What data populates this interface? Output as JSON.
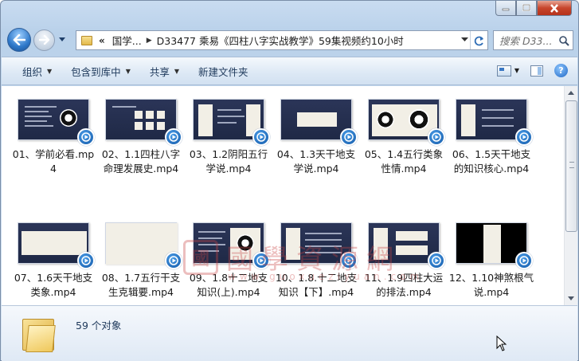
{
  "window": {
    "minimize_icon": "minimize-icon",
    "maximize_icon": "maximize-icon",
    "close_icon": "close-icon"
  },
  "address": {
    "prefix": "«",
    "segments": [
      "国学...",
      "D33477 乘易《四柱八字实战教学》59集视频约10小时"
    ]
  },
  "search": {
    "placeholder": "搜索 D33..."
  },
  "toolbar": {
    "organize": "组织",
    "include_library": "包含到库中",
    "share": "共享",
    "new_folder": "新建文件夹"
  },
  "items": [
    {
      "name": "01、学前必看.mp4",
      "thumb": "text"
    },
    {
      "name": "02、1.1四柱八字命理发展史.mp4",
      "thumb": "grid"
    },
    {
      "name": "03、1.2阴阳五行学说.mp4",
      "thumb": "scroll"
    },
    {
      "name": "04、1.3天干地支学说.mp4",
      "thumb": "title"
    },
    {
      "name": "05、1.4五行类象性情.mp4",
      "thumb": "taiji"
    },
    {
      "name": "06、1.5天干地支的知识核心.mp4",
      "thumb": "scroll2"
    },
    {
      "name": "07、1.6天干地支类象.mp4",
      "thumb": "title2"
    },
    {
      "name": "08、1.7五行干支生克辑要.mp4",
      "thumb": "light"
    },
    {
      "name": "09、1.8十二地支知识(上).mp4",
      "thumb": "chart"
    },
    {
      "name": "10、1.8.十二地支知识【下】.mp4",
      "thumb": "scroll3"
    },
    {
      "name": "11、1.9四柱大运的排法.mp4",
      "thumb": "scroll4"
    },
    {
      "name": "12、1.10神煞根气说.mp4",
      "thumb": "dark"
    }
  ],
  "status": {
    "count": "59 个对象"
  }
}
